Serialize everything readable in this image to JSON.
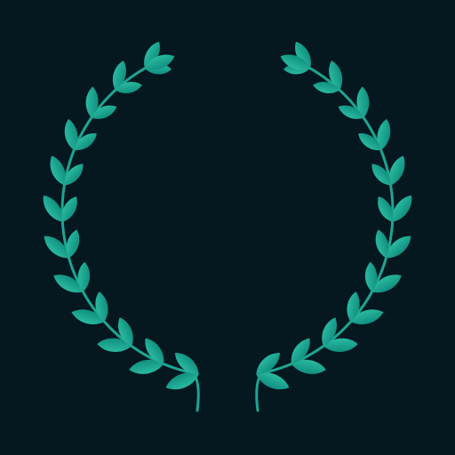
{
  "scene": {
    "subject": "laurel-wreath",
    "colors": {
      "background": "#051820",
      "leaf_light": "#2ab9a0",
      "leaf_dark": "#109080",
      "stem": "#1da592"
    },
    "branches": [
      {
        "side": "left",
        "leaf_pairs": 12,
        "top_leaf": true
      },
      {
        "side": "right",
        "leaf_pairs": 12,
        "top_leaf": true
      }
    ]
  }
}
